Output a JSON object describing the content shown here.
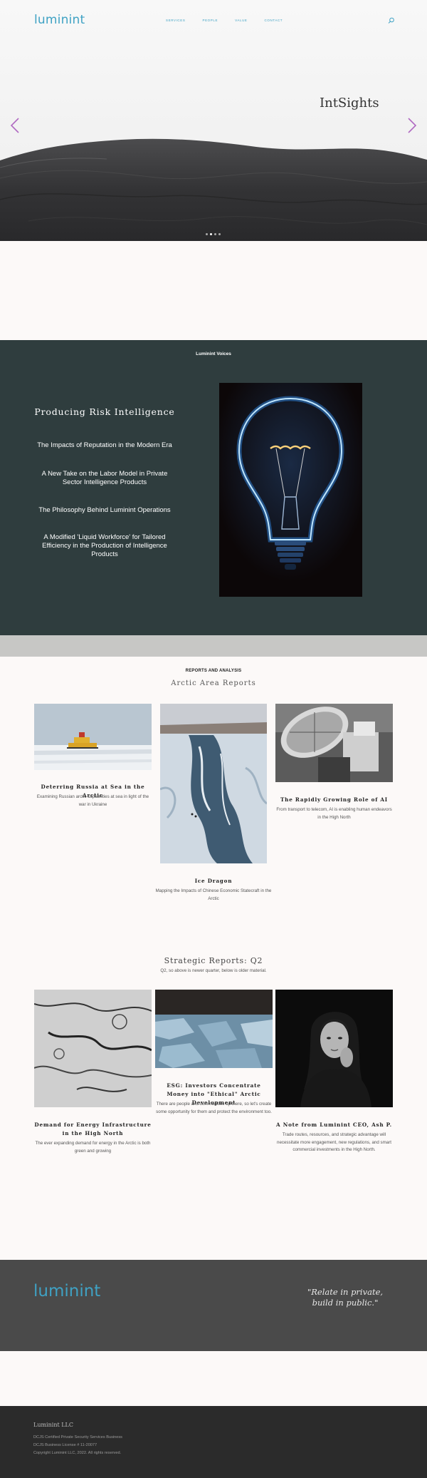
{
  "brand": {
    "logo": "luminint",
    "accent": "#3fa2c4"
  },
  "nav": {
    "items": [
      "SERVICES",
      "PEOPLE",
      "VALUE",
      "CONTACT"
    ]
  },
  "hero": {
    "title": "IntSights",
    "slide_count": 4,
    "active_slide": 2
  },
  "voices": {
    "heading": "Luminint Voices",
    "title": "Producing Risk Intelligence",
    "links": [
      "The Impacts of Reputation in the Modern Era",
      "A New Take on the Labor Model in Private Sector Intelligence Products",
      "The Philosophy Behind Luminint Operations",
      "A Modified 'Liquid Workforce' for Tailored Efficiency in the Production of Intelligence Products"
    ]
  },
  "reports": {
    "kicker": "REPORTS AND ANALYSIS",
    "title": "Arctic Area Reports",
    "cards": [
      {
        "title": "Deterring Russia at Sea in the Arctic",
        "desc": "Examining Russian arctic capabilities at sea in light of the war in Ukraine"
      },
      {
        "title": "Ice Dragon",
        "desc": "Mapping the Impacts of Chinese Economic Statecraft in the Arctic"
      },
      {
        "title": "The Rapidly Growing Role of AI",
        "desc": "From transport to telecom, AI is enabling human endeavors in the High North"
      }
    ]
  },
  "strategic": {
    "title": "Strategic Reports: Q2",
    "subtitle": "Q2, so above is newer quarter, below is older material.",
    "cards": [
      {
        "title": "Demand for Energy Infrastructure in the High North",
        "desc": "The ever expanding demand for energy in the Arctic is both green and growing"
      },
      {
        "title": "ESG: Investors Concentrate Money into \"Ethical\" Arctic Development",
        "desc": "There are people and communities up there, so let's create some opportunity for them and protect the environment too."
      },
      {
        "title": "A Note from Luminint CEO, Ash P.",
        "desc": "Trade routes, resources, and strategic advantage will necessitate more engagement, new regulations, and smart commercial investments in the High North."
      }
    ]
  },
  "quote_band": {
    "logo": "luminint",
    "quote": "\"Relate in private, build in public.\""
  },
  "footer": {
    "name": "Luminint LLC",
    "lines": [
      "DCJS Certified Private Security Services Business",
      "DCJS Business License # 11-20077",
      "Copyright Luminint LLC, 2022. All rights reserved."
    ]
  }
}
